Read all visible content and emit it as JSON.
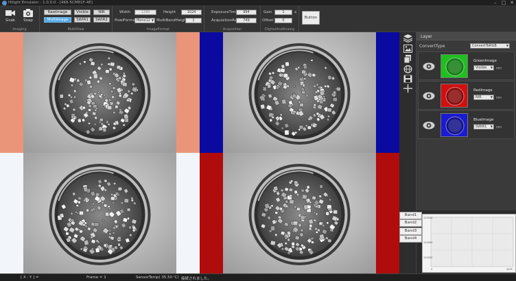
{
  "window": {
    "title": "Hilight Emulator - 1.0.0.0 - [4K6-5CM81F-4E]",
    "minimize_glyph": "–",
    "maximize_glyph": "□",
    "close_glyph": "✕"
  },
  "ribbon": {
    "imaging": {
      "label": "Imaging",
      "grab_label": "Grab",
      "snap_label": "Snap"
    },
    "multiview": {
      "label": "MultiView",
      "buttons": [
        "RawImage",
        "Visible",
        "NIR",
        "MultiImage",
        "SWIR1",
        "SWIR2"
      ]
    },
    "imageformat": {
      "label": "ImageFormat",
      "width_label": "Width",
      "width_value": "1280",
      "height_label": "Height",
      "height_value": "1024",
      "pixelformat_label": "PixelFormat",
      "pixelformat_value": "Mono12",
      "multibandheight_label": "MultiBandHeight",
      "multibandheight_value": "1"
    },
    "acquisition": {
      "label": "Acquisition",
      "exposure_label": "ExposureTime",
      "exposure_value": "994",
      "rate_label": "AcquisitionRate",
      "rate_value": "749"
    },
    "digitalanalog": {
      "label": "DigitalAndAnalog",
      "gain_label": "Gain",
      "gain_value": "1",
      "gain_unit": "x",
      "offset_label": "Offset",
      "offset_value": "0"
    },
    "button_label": "Button"
  },
  "layer_panel": {
    "title": "Layer",
    "convert_label": "ConvertType",
    "convert_value": "ConvertToRGB",
    "layers": [
      {
        "name": "GreenImage",
        "band": "Visible",
        "unit": "nm",
        "color": "#1fbf1f"
      },
      {
        "name": "RedImage",
        "band": "NIR",
        "unit": "nm",
        "color": "#d01010"
      },
      {
        "name": "BlueImage",
        "band": "SWIR1",
        "unit": "nm",
        "color": "#1a1ad0"
      }
    ]
  },
  "bands": [
    "Band1",
    "Band2",
    "Band3",
    "Band4"
  ],
  "chart": {
    "y_ticks": [
      "120000",
      "120000",
      "120000"
    ],
    "x_ticks": [
      "0",
      "4095"
    ]
  },
  "views": [
    {
      "name": "view-top-left",
      "left_color": "#ea9579",
      "right_color": "#ea9579"
    },
    {
      "name": "view-top-right",
      "left_color": "#0a0aa0",
      "right_color": "#0a0aa0"
    },
    {
      "name": "view-bottom-left",
      "left_color": "#f2f6fb",
      "right_color": "#f2f6fb"
    },
    {
      "name": "view-bottom-right",
      "left_color": "#b00c0c",
      "right_color": "#b00c0c"
    }
  ],
  "status": {
    "coords": "[ X : Y ] =",
    "frame": "Frame = 1",
    "sensor_temp": "SensorTemp( 35.50 'C)",
    "message": "接続されました。"
  },
  "icons": [
    "video-camera-icon",
    "camera-icon",
    "layers-icon",
    "image-icon",
    "copy-icon",
    "globe-icon",
    "save-icon",
    "move-icon",
    "eye-icon"
  ]
}
